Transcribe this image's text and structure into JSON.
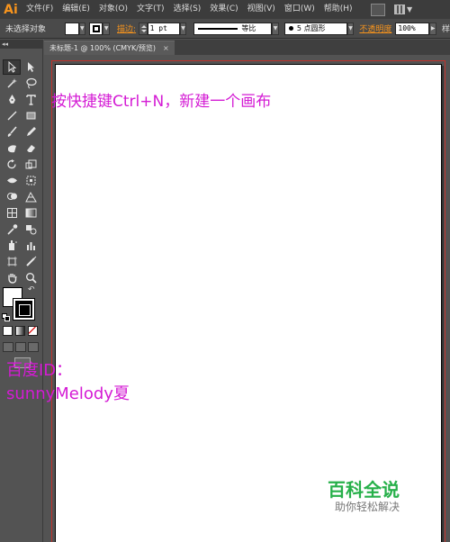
{
  "app": {
    "logo": "Ai"
  },
  "menu": [
    "文件(F)",
    "编辑(E)",
    "对象(O)",
    "文字(T)",
    "选择(S)",
    "效果(C)",
    "视图(V)",
    "窗口(W)",
    "帮助(H)"
  ],
  "control": {
    "selection_label": "未选择对象",
    "stroke_label": "描边:",
    "stroke_value": "1 pt",
    "profile_label": "等比",
    "brush_label": "5 点圆形",
    "opacity_label": "不透明度",
    "opacity_value": "100%",
    "style_label": "样"
  },
  "panel": {
    "collapse_glyph": "◂◂"
  },
  "tab": {
    "title": "未标题-1 @ 100% (CMYK/预览)",
    "close": "×"
  },
  "canvas": {
    "instruction": "按快捷键Ctrl+N，新建一个画布"
  },
  "watermark": {
    "line1": "百度ID：",
    "line2": "sunnyMelody夏",
    "brand": "百科全说",
    "brand_sub": "助你轻松解决"
  },
  "colors": {
    "annotation": "#d41bd4",
    "brand": "#27b04a",
    "accent": "#f7941d",
    "bleed": "#c0312b"
  }
}
